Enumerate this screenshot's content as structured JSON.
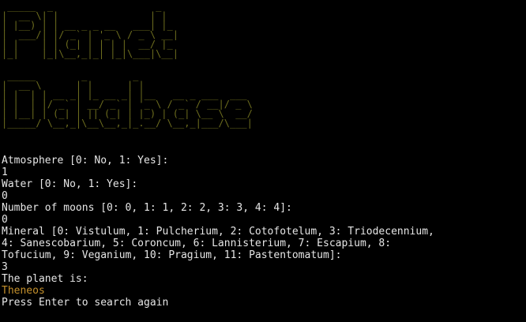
{
  "banner": {
    "title_line1": " _____  _                  _   \n|  __ \\| |                | |  \n| |__) | | __ _ _ __   ___| |_ \n|  ___/| |/ _` | '_ \\ / _ \\ __|\n| |    | | (_| | | | |  __/ |_ \n|_|    |_|\\__,_|_| |_|\\___|\\__|",
    "title_line2": " _____        _        _                    \n|  __ \\      | |      | |                   \n| |  | | __ _| |_ __ _| |__   __ _ ___  ___ \n| |  | |/ _` | __/ _` | '_ \\ / _` / __|/ _ \\\n| |__| | (_| | || (_| | |_) | (_| \\__ \\  __/\n|_____/ \\__,_|\\__\\__,_|_.__/ \\__,_|___/\\___|",
    "color": "#6d6d1e"
  },
  "session": {
    "prompt_atmosphere": "Atmosphere [0: No, 1: Yes]:",
    "answer_atmosphere": "1",
    "prompt_water": "Water [0: No, 1: Yes]:",
    "answer_water": "0",
    "prompt_moons": "Number of moons [0: 0, 1: 1, 2: 2, 3: 3, 4: 4]:",
    "answer_moons": "0",
    "prompt_mineral_line1": "Mineral [0: Vistulum, 1: Pulcherium, 2: Cotofotelum, 3: Triodecennium,",
    "prompt_mineral_line2": "4: Sanescobarium, 5: Coroncum, 6: Lannisterium, 7: Escapium, 8:",
    "prompt_mineral_line3": "Tofucium, 9: Veganium, 10: Pragium, 11: Pastentomatum]:",
    "answer_mineral": "3",
    "result_label": "The planet is:",
    "result_value": "Theneos",
    "press_enter": "Press Enter to search again",
    "cursor_glyph": "_"
  },
  "colors": {
    "background": "#000000",
    "text": "#e6e6e6",
    "result": "#c4902c"
  }
}
